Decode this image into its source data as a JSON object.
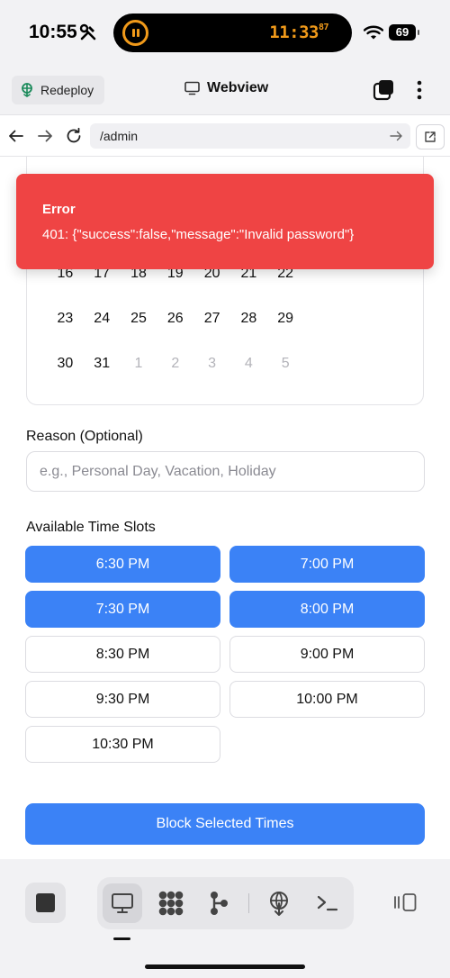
{
  "status_bar": {
    "time": "10:55",
    "timer_time": "11:33",
    "timer_fraction": "87",
    "battery": "69"
  },
  "header": {
    "redeploy_label": "Redeploy",
    "title": "Webview"
  },
  "url_bar": {
    "url": "/admin"
  },
  "calendar": {
    "weeks": [
      [
        {
          "d": "16",
          "m": false
        },
        {
          "d": "17",
          "m": false
        },
        {
          "d": "18",
          "m": false
        },
        {
          "d": "19",
          "m": false
        },
        {
          "d": "20",
          "m": false
        },
        {
          "d": "21",
          "m": false
        },
        {
          "d": "22",
          "m": false
        }
      ],
      [
        {
          "d": "23",
          "m": false
        },
        {
          "d": "24",
          "m": false
        },
        {
          "d": "25",
          "m": false
        },
        {
          "d": "26",
          "m": false
        },
        {
          "d": "27",
          "m": false
        },
        {
          "d": "28",
          "m": false
        },
        {
          "d": "29",
          "m": false
        }
      ],
      [
        {
          "d": "30",
          "m": false
        },
        {
          "d": "31",
          "m": false
        },
        {
          "d": "1",
          "m": true
        },
        {
          "d": "2",
          "m": true
        },
        {
          "d": "3",
          "m": true
        },
        {
          "d": "4",
          "m": true
        },
        {
          "d": "5",
          "m": true
        }
      ]
    ]
  },
  "reason": {
    "label": "Reason (Optional)",
    "placeholder": "e.g., Personal Day, Vacation, Holiday",
    "value": ""
  },
  "slots": {
    "label": "Available Time Slots",
    "items": [
      {
        "time": "6:30 PM",
        "selected": true
      },
      {
        "time": "7:00 PM",
        "selected": true
      },
      {
        "time": "7:30 PM",
        "selected": true
      },
      {
        "time": "8:00 PM",
        "selected": true
      },
      {
        "time": "8:30 PM",
        "selected": false
      },
      {
        "time": "9:00 PM",
        "selected": false
      },
      {
        "time": "9:30 PM",
        "selected": false
      },
      {
        "time": "10:00 PM",
        "selected": false
      },
      {
        "time": "10:30 PM",
        "selected": false
      }
    ]
  },
  "block_button_label": "Block Selected Times",
  "error_toast": {
    "title": "Error",
    "message": "401: {\"success\":false,\"message\":\"Invalid password\"}"
  },
  "colors": {
    "primary": "#3b82f6",
    "error": "#ef4444",
    "timer": "#f19a1a"
  },
  "bottom_bar": {
    "active_tool": "webview"
  }
}
